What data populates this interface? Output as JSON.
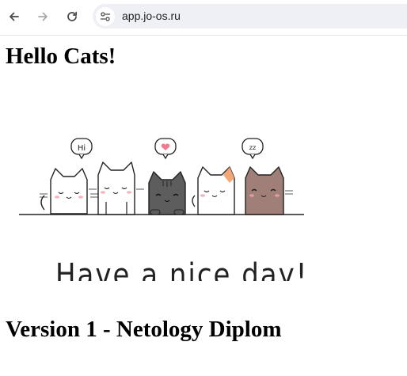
{
  "browser": {
    "url": "app.jo-os.ru",
    "icons": {
      "back": "arrow-left-icon",
      "forward": "arrow-right-icon",
      "reload": "reload-icon",
      "site_info": "tune-icon"
    }
  },
  "page": {
    "heading": "Hello Cats!",
    "image": {
      "speech_bubbles": [
        "Hi",
        "heart",
        "zz"
      ],
      "caption": "Have a nice day!"
    },
    "version_heading": "Version 1 - Netology Diplom"
  }
}
